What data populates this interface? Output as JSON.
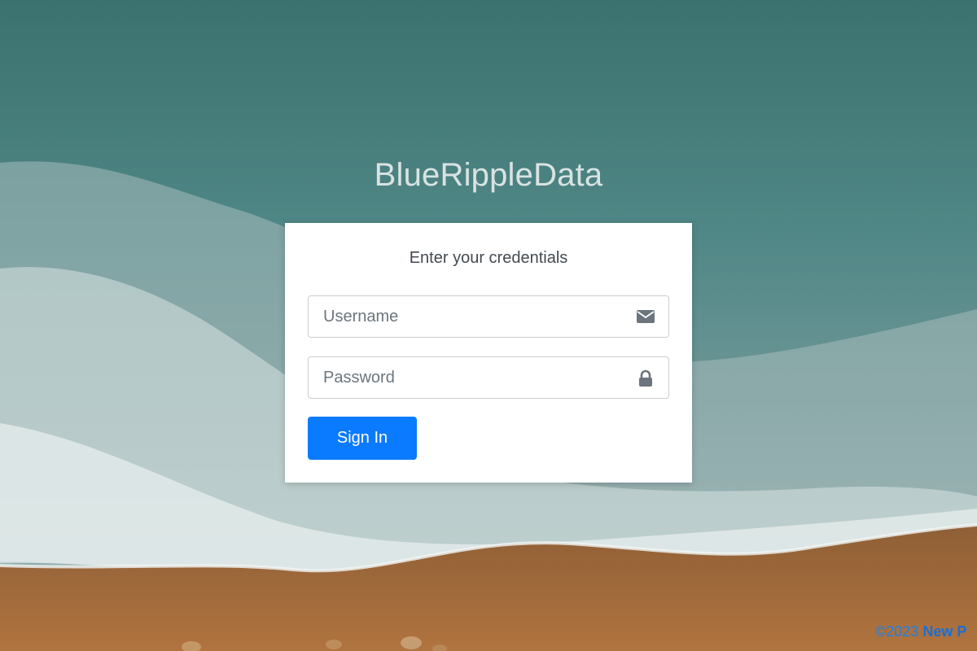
{
  "brand": {
    "title": "BlueRippleData"
  },
  "login": {
    "heading": "Enter your credentials",
    "username_placeholder": "Username",
    "password_placeholder": "Password",
    "username_icon": "envelope-icon",
    "password_icon": "lock-icon",
    "submit_label": "Sign In"
  },
  "footer": {
    "copyright": "©2023",
    "company_partial": "New P"
  },
  "colors": {
    "primary_button": "#0a7bff",
    "footer_link": "#1f7fe6",
    "brand_text": "#d9e3e2"
  }
}
